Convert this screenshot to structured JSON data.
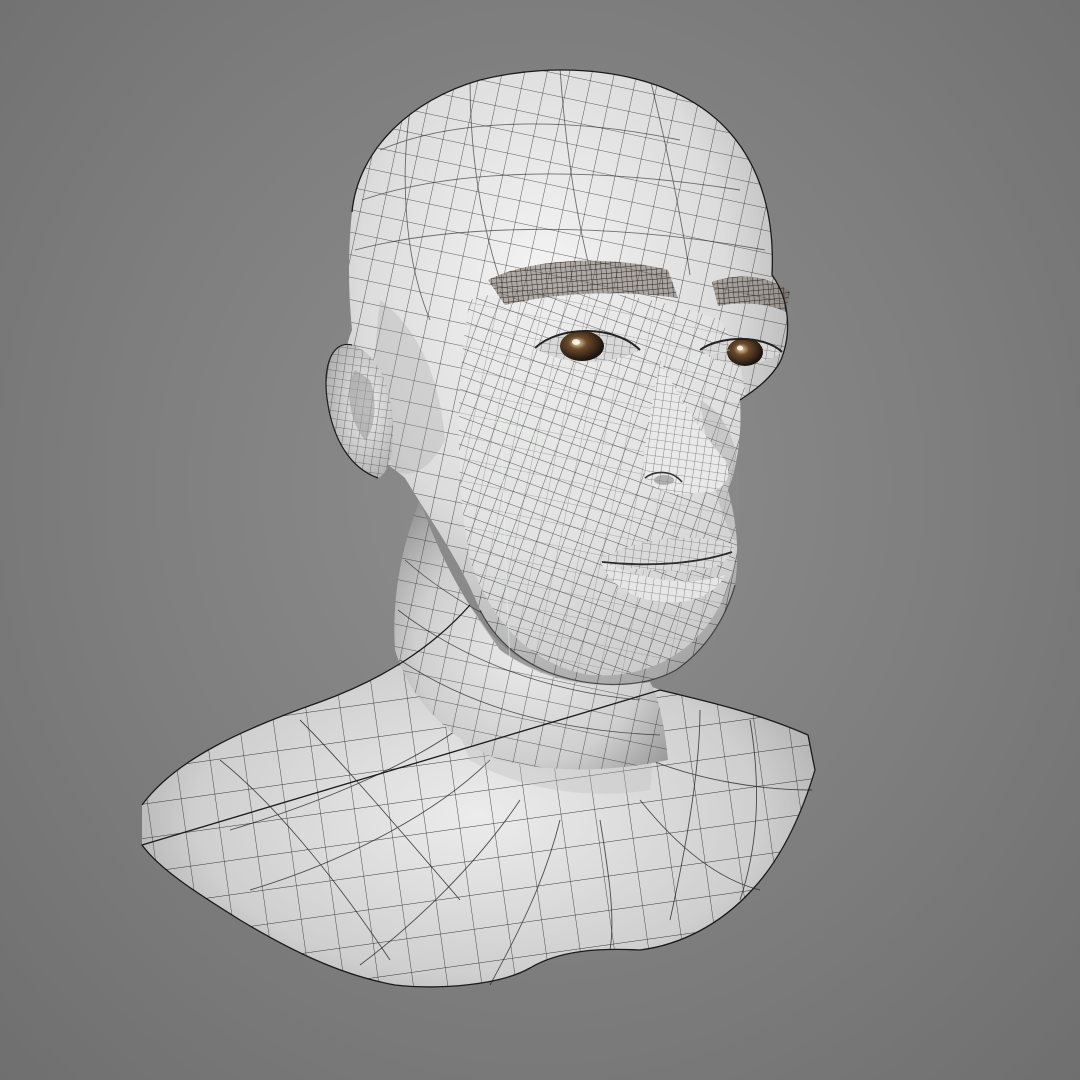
{
  "scene": {
    "subject": "wireframe-head-bust",
    "render_mode": "wireframe-on-shaded",
    "colors": {
      "background": "#7f7f7f",
      "skin_light": "#f2f2f2",
      "skin_mid": "#cfcfcf",
      "skin_shadow": "#8c8c8c",
      "wire": "#1c1c1c",
      "iris": "#4a3422",
      "brow": "#5a524a"
    }
  }
}
